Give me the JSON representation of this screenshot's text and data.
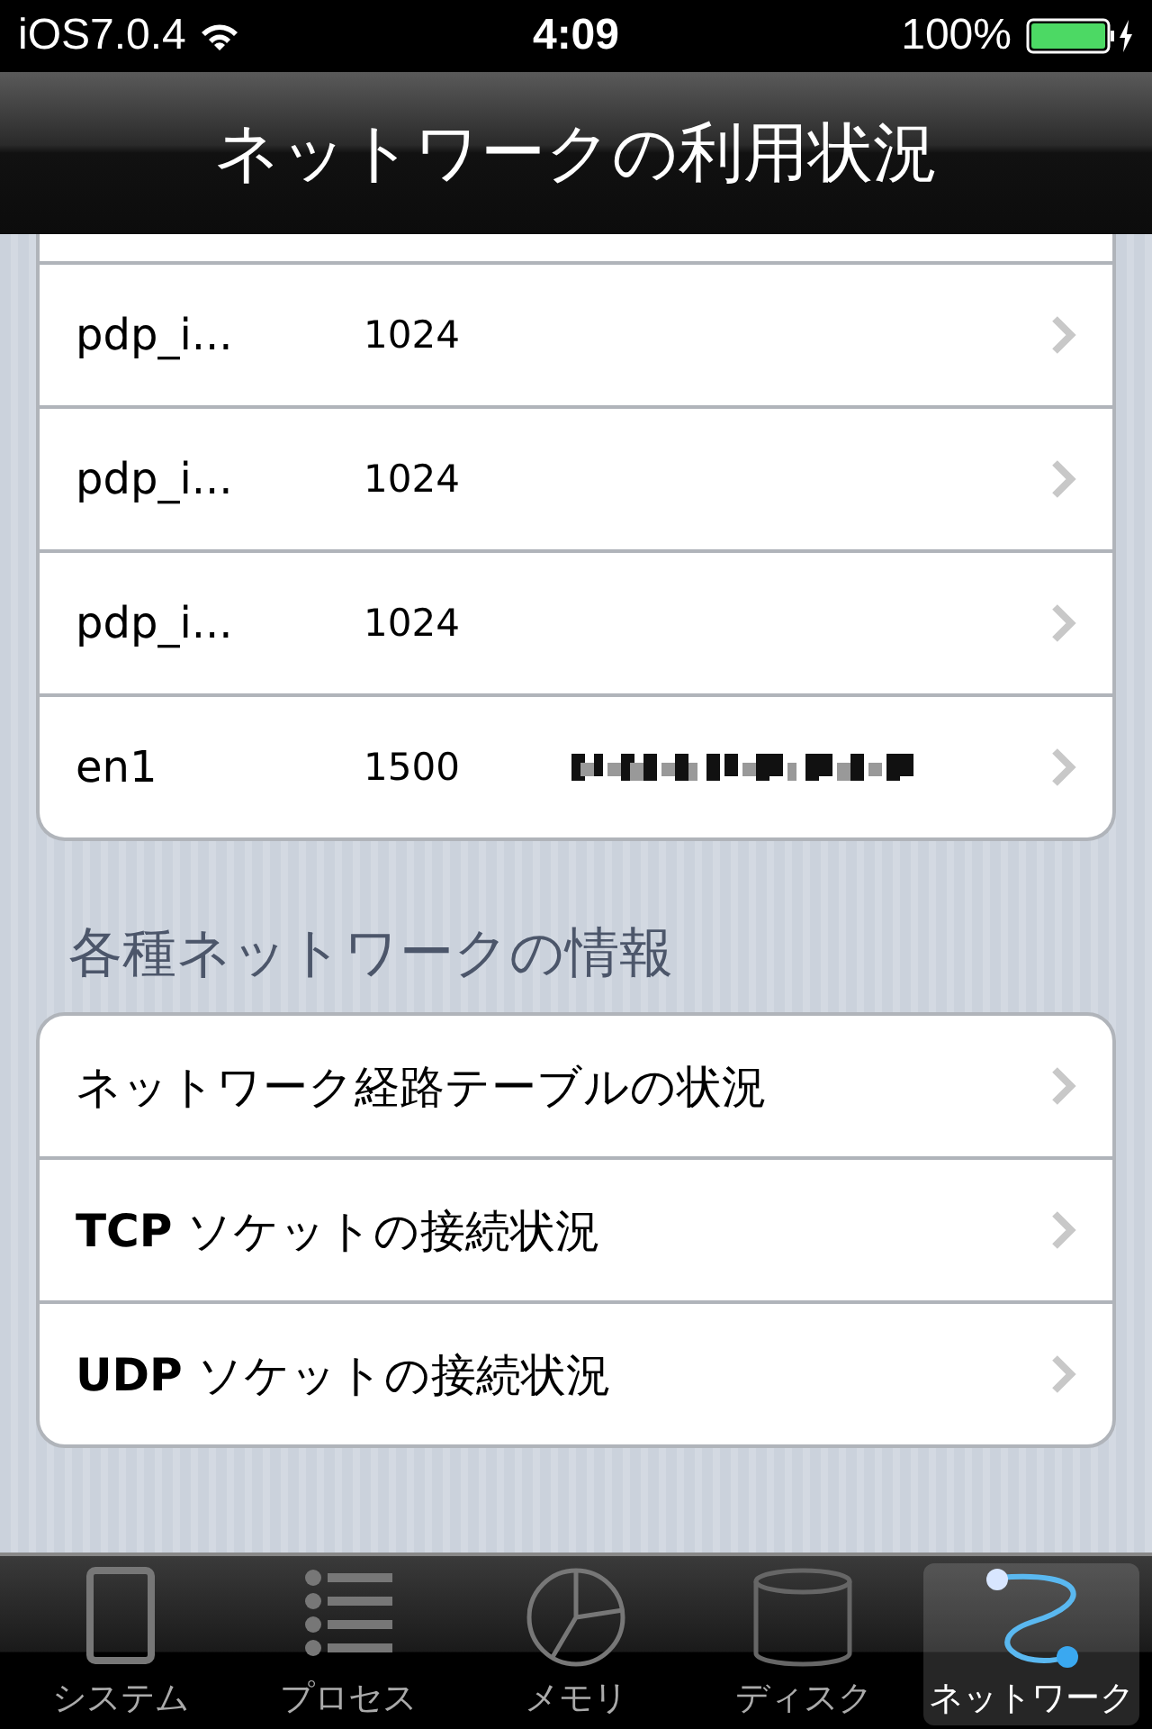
{
  "status_bar": {
    "carrier": "iOS7.0.4",
    "time": "4:09",
    "battery": "100%"
  },
  "nav_bar": {
    "title": "ネットワークの利用状況"
  },
  "interfaces": [
    {
      "name": "pdp_i...",
      "mtu": "1024",
      "redacted": false
    },
    {
      "name": "pdp_i...",
      "mtu": "1024",
      "redacted": false
    },
    {
      "name": "pdp_i...",
      "mtu": "1024",
      "redacted": false
    },
    {
      "name": "en1",
      "mtu": "1500",
      "redacted": true
    }
  ],
  "info_section": {
    "header": "各種ネットワークの情報",
    "items": [
      {
        "label": "ネットワーク経路テーブルの状況"
      },
      {
        "label": "**TCP** ソケットの接続状況"
      },
      {
        "label": "**UDP** ソケットの接続状況"
      }
    ]
  },
  "tab_bar": [
    {
      "label": "システム",
      "kind": "phone",
      "selected": false
    },
    {
      "label": "プロセス",
      "kind": "list",
      "selected": false
    },
    {
      "label": "メモリ",
      "kind": "pie",
      "selected": false
    },
    {
      "label": "ディスク",
      "kind": "disk",
      "selected": false
    },
    {
      "label": "ネットワーク",
      "kind": "network",
      "selected": true
    }
  ]
}
